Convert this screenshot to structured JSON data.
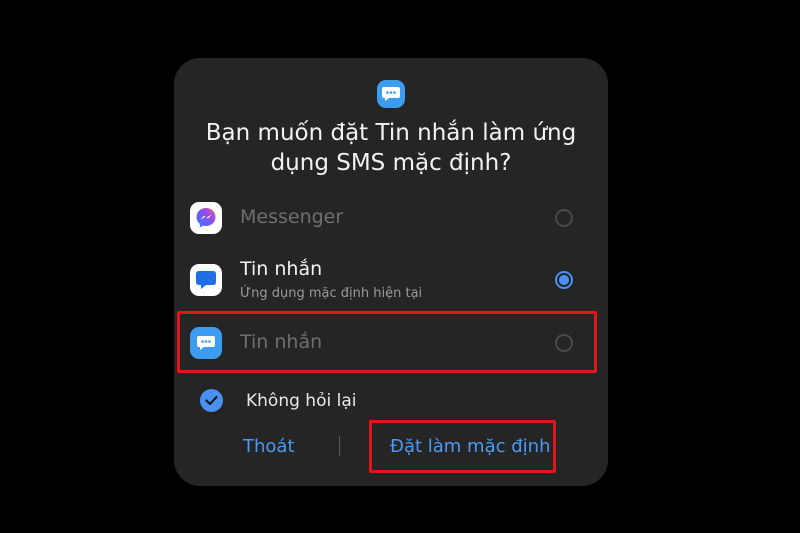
{
  "dialog": {
    "title": "Bạn muốn đặt Tin nhắn làm ứng dụng SMS mặc định?",
    "options": [
      {
        "label": "Messenger",
        "subtitle": "",
        "icon": "messenger-icon",
        "selected": false,
        "enabled": false
      },
      {
        "label": "Tin nhắn",
        "subtitle": "Ứng dụng mặc định hiện tại",
        "icon": "samsung-messages-icon",
        "selected": true,
        "enabled": true
      },
      {
        "label": "Tin nhắn",
        "subtitle": "",
        "icon": "chat-bubble-icon",
        "selected": false,
        "enabled": false
      }
    ],
    "dont_ask_again": {
      "label": "Không hỏi lại",
      "checked": true
    },
    "buttons": {
      "cancel": "Thoát",
      "confirm": "Đặt làm mặc định"
    }
  },
  "colors": {
    "background": "#000000",
    "dialog": "#252525",
    "accent": "#4a90f0",
    "annotation": "#e0161b"
  }
}
